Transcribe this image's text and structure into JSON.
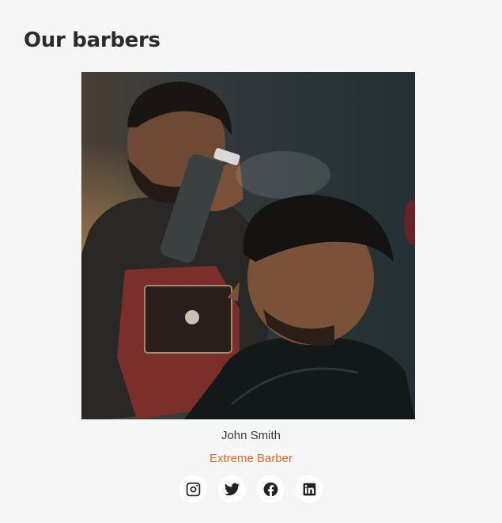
{
  "section": {
    "title": "Our barbers"
  },
  "barber": {
    "name": "John Smith",
    "role": "Extreme Barber",
    "role_color": "#e06a2a",
    "photo_icon": "barber-photo"
  },
  "socials": [
    {
      "icon": "instagram-icon"
    },
    {
      "icon": "twitter-icon"
    },
    {
      "icon": "facebook-icon"
    },
    {
      "icon": "linkedin-icon"
    }
  ]
}
